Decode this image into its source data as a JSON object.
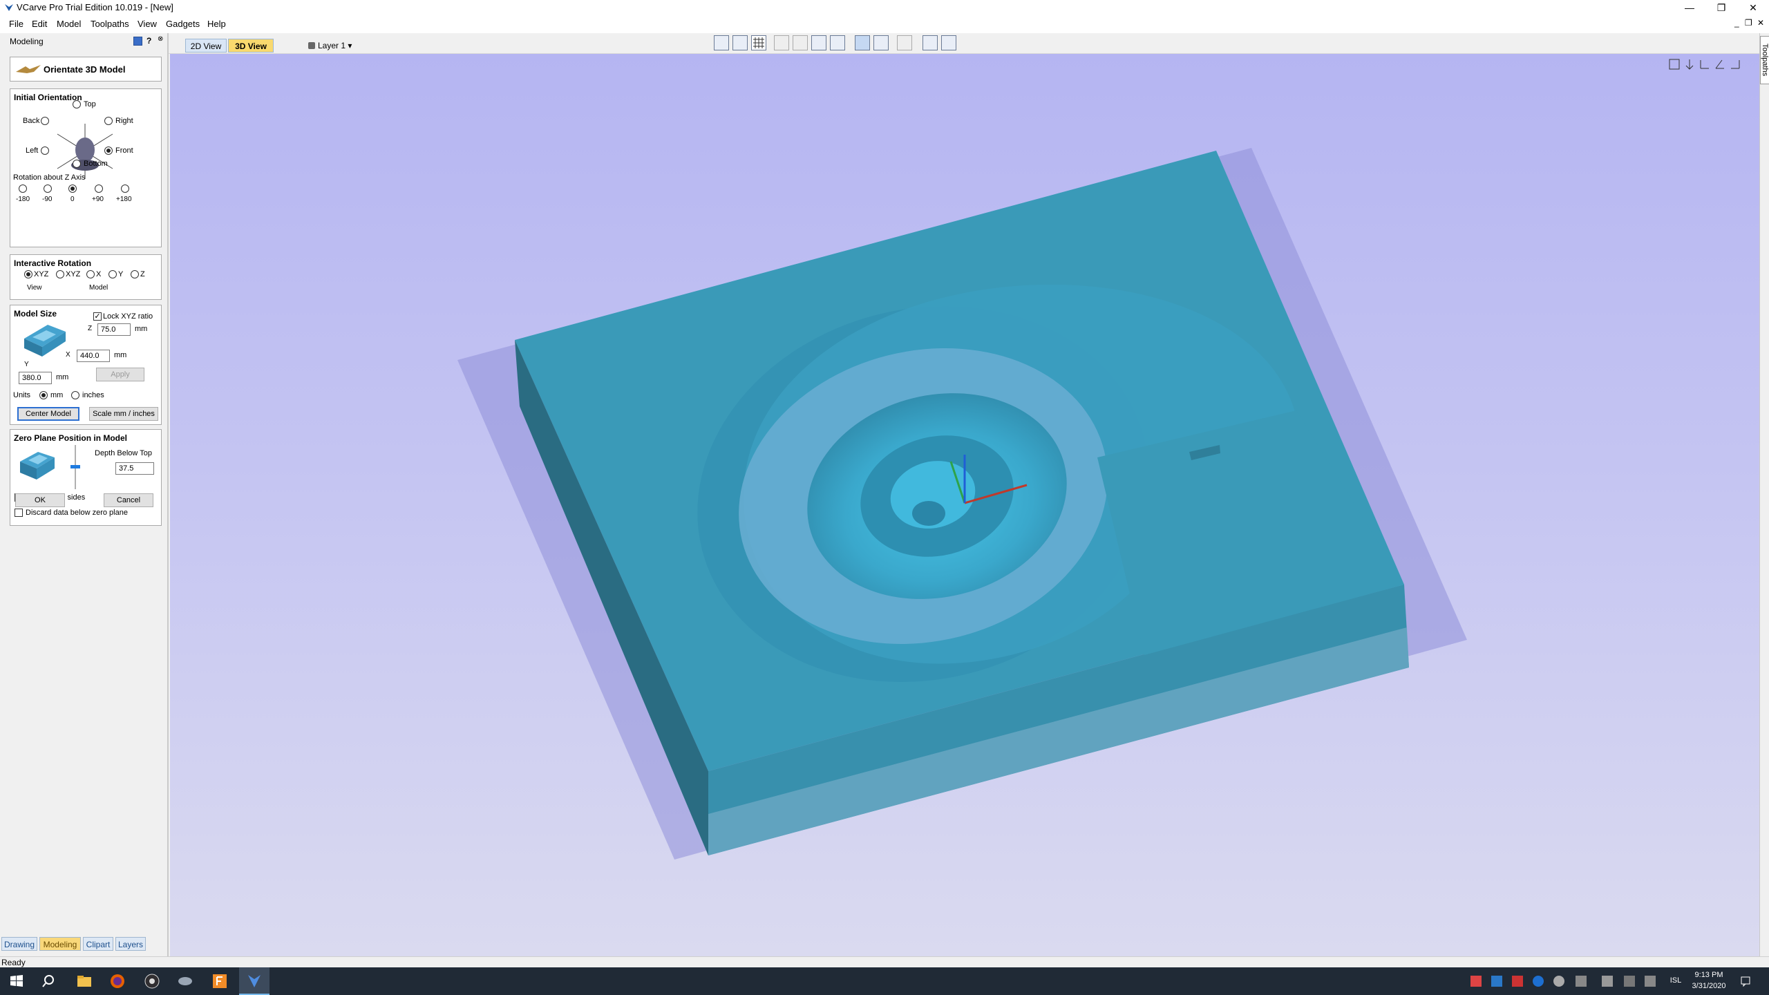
{
  "window": {
    "title": "VCarve Pro Trial Edition 10.019 - [New]",
    "minimize_icon": "minimize-icon",
    "maximize_icon": "restore-icon",
    "close_icon": "close-icon"
  },
  "menu": [
    "File",
    "Edit",
    "Model",
    "Toolpaths",
    "View",
    "Gadgets",
    "Help"
  ],
  "mdi": {
    "minimize": "_",
    "restore": "❐",
    "close": "✕"
  },
  "panel": {
    "title": "Modeling",
    "help": "?",
    "pin": "📌",
    "header_title": "Orientate 3D Model",
    "initial_orientation": {
      "title": "Initial Orientation",
      "top": "Top",
      "back": "Back",
      "right": "Right",
      "left": "Left",
      "front": "Front",
      "bottom": "Bottom",
      "rotation_label": "Rotation about Z Axis",
      "rotations": [
        "-180",
        "-90",
        "0",
        "+90",
        "+180"
      ],
      "selected_rotation": "0",
      "selected_orientation": "Front"
    },
    "interactive_rotation": {
      "title": "Interactive Rotation",
      "options": [
        "XYZ",
        "XYZ",
        "X",
        "Y",
        "Z"
      ],
      "selected": 0,
      "view_label": "View",
      "model_label": "Model"
    },
    "model_size": {
      "title": "Model Size",
      "lock_label": "Lock XYZ ratio",
      "lock_checked": true,
      "z_axis": "Z",
      "x_axis": "X",
      "y_axis": "Y",
      "z_value": "75.0",
      "x_value": "440.0",
      "y_value": "380.0",
      "unit": "mm",
      "apply": "Apply",
      "units_label": "Units",
      "mm": "mm",
      "inches": "inches",
      "units_selected": "mm",
      "center_model": "Center Model",
      "scale": "Scale mm / inches"
    },
    "zero_plane": {
      "title": "Zero Plane Position in Model",
      "depth_label": "Depth Below Top",
      "depth_value": "37.5",
      "create_both": "Create both sides",
      "discard": "Discard data below zero plane"
    },
    "ok": "OK",
    "cancel": "Cancel",
    "tabs": [
      "Drawing",
      "Modeling",
      "Clipart",
      "Layers"
    ],
    "active_tab": "Modeling"
  },
  "view_tabs": [
    "2D View",
    "3D View"
  ],
  "active_view": "3D View",
  "layer": "Layer 1",
  "right_strip_label": "Toolpaths",
  "status": "Ready",
  "taskbar": {
    "language": "ISL",
    "time": "9:13 PM",
    "date": "3/31/2020"
  },
  "colors": {
    "model_top": "#3a9ab8",
    "model_side": "#2a7088",
    "background_top": "#b5b5f2",
    "active_tab": "#f9d96e"
  }
}
